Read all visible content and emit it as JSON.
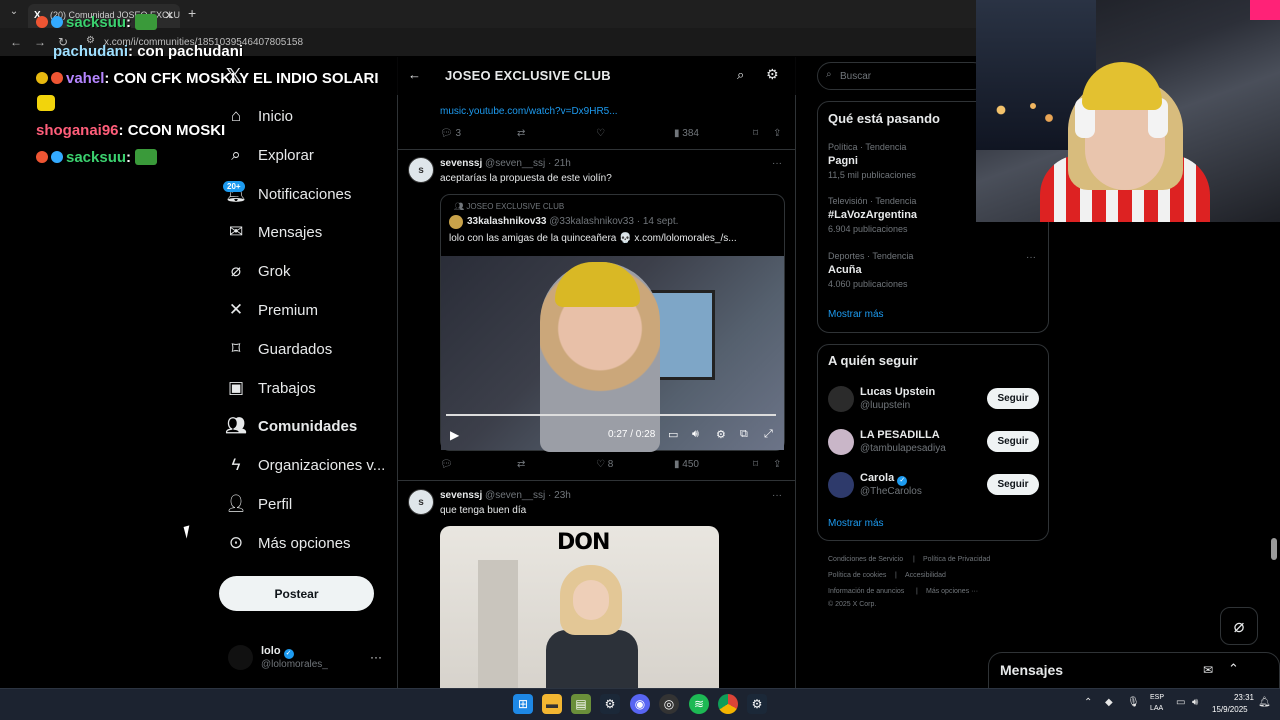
{
  "browser": {
    "tab_title": "(20) Comunidad JOSEO EXCLUS",
    "url": "x.com/i/communities/1851039546407805158"
  },
  "chat": [
    {
      "user": "sacksuu",
      "msg": "",
      "user_color": "#3bd16f"
    },
    {
      "user": "pachudani",
      "msg": "con pachudani",
      "user_color": "#9fe0ff"
    },
    {
      "user": "vahel",
      "msg": "CON CFK MOSKI Y EL INDIO SOLARI",
      "user_color": "#b585ff"
    },
    {
      "user": "shoganai96",
      "msg": "CCON MOSKI",
      "user_color": "#ff5e7a"
    },
    {
      "user": "sacksuu",
      "msg": "",
      "user_color": "#3bd16f"
    }
  ],
  "nav": {
    "items": [
      {
        "label": "Inicio",
        "icon": "home-icon"
      },
      {
        "label": "Explorar",
        "icon": "search-icon"
      },
      {
        "label": "Notificaciones",
        "icon": "bell-icon"
      },
      {
        "label": "Mensajes",
        "icon": "mail-icon"
      },
      {
        "label": "Grok",
        "icon": "grok-icon"
      },
      {
        "label": "Premium",
        "icon": "x-logo-icon"
      },
      {
        "label": "Guardados",
        "icon": "bookmark-icon"
      },
      {
        "label": "Trabajos",
        "icon": "briefcase-icon"
      },
      {
        "label": "Comunidades",
        "icon": "people-icon"
      },
      {
        "label": "Organizaciones v...",
        "icon": "lightning-icon"
      },
      {
        "label": "Perfil",
        "icon": "person-icon"
      },
      {
        "label": "Más opciones",
        "icon": "more-circle-icon"
      }
    ],
    "notif_badge": "20+",
    "post_label": "Postear",
    "account": {
      "name": "lolo",
      "handle": "@lolomorales_"
    }
  },
  "community": {
    "title": "JOSEO EXCLUSIVE CLUB"
  },
  "tweets": [
    {
      "link": "music.youtube.com/watch?v=Dx9HR5...",
      "replies": "3",
      "retweets": "",
      "likes": "",
      "views": "384"
    },
    {
      "name": "sevenssj",
      "handle": "@seven__ssj",
      "time": "21h",
      "text": "aceptarías la propuesta de este violín?",
      "quote": {
        "community": "JOSEO EXCLUSIVE CLUB",
        "name": "33kalashnikov33",
        "handle": "@33kalashnikov33",
        "time": "14 sept.",
        "text": "lolo con las amigas de la quinceañera 💀 x.com/lolomorales_/s...",
        "video_time": "0:27 / 0:28"
      },
      "replies": "",
      "retweets": "",
      "likes": "8",
      "views": "450"
    },
    {
      "name": "sevenssj",
      "handle": "@seven__ssj",
      "time": "23h",
      "text": "que tenga buen día",
      "image_caption": "DON"
    }
  ],
  "right": {
    "search_placeholder": "Buscar",
    "trends_title": "Qué está pasando",
    "trends": [
      {
        "meta": "Política · Tendencia",
        "name": "Pagni",
        "count": "11,5 mil publicaciones"
      },
      {
        "meta": "Televisión · Tendencia",
        "name": "#LaVozArgentina",
        "count": "6.904 publicaciones"
      },
      {
        "meta": "Deportes · Tendencia",
        "name": "Acuña",
        "count": "4.060 publicaciones"
      }
    ],
    "show_more": "Mostrar más",
    "follow_title": "A quién seguir",
    "follow": [
      {
        "name": "Lucas Upstein",
        "handle": "@luupstein",
        "verified": false,
        "color": "#2b2b2b"
      },
      {
        "name": "LA PESADILLA",
        "handle": "@tambulapesadiya",
        "verified": false,
        "color": "#c9b6c8"
      },
      {
        "name": "Carola",
        "handle": "@TheCarolos",
        "verified": true,
        "color": "#2e3a6b"
      }
    ],
    "follow_label": "Seguir",
    "footer": [
      "Condiciones de Servicio",
      "Política de Privacidad",
      "Política de cookies",
      "Accesibilidad",
      "Información de anuncios",
      "Más opciones ···",
      "© 2025 X Corp."
    ]
  },
  "dm": {
    "title": "Mensajes"
  },
  "taskbar": {
    "lang1": "ESP",
    "lang2": "LAA",
    "time": "23:31",
    "date": "15/9/2025"
  }
}
